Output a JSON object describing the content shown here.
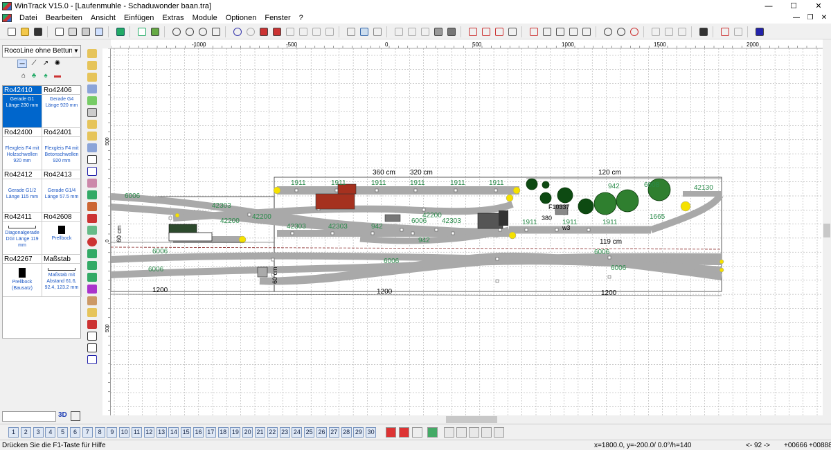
{
  "app": {
    "title": "WinTrack  V15.0 - [Laufenmuhle - Schaduwonder baan.tra]",
    "window_controls": [
      "—",
      "☐",
      "✕"
    ],
    "mdi_controls": [
      "—",
      "❐",
      "✕"
    ]
  },
  "menu": [
    "Datei",
    "Bearbeiten",
    "Ansicht",
    "Einfügen",
    "Extras",
    "Module",
    "Optionen",
    "Fenster",
    "?"
  ],
  "library": {
    "selected": "RocoLine ohne Bettung H",
    "parts": [
      {
        "id": "Ro42410",
        "desc": "Gerade G1 Länge 230 mm",
        "selected": true,
        "kind": "text"
      },
      {
        "id": "Ro42406",
        "desc": "Gerade G4 Länge 920 mm",
        "selected": false,
        "kind": "text"
      },
      {
        "id": "Ro42400",
        "desc": "Flexgleis F4 mit Holzschwellen 920 mm",
        "selected": false,
        "kind": "text"
      },
      {
        "id": "Ro42401",
        "desc": "Flexgleis F4 mit Betonschwellen 920 mm",
        "selected": false,
        "kind": "text"
      },
      {
        "id": "Ro42412",
        "desc": "Gerade G1/2 Länge 115 mm",
        "selected": false,
        "kind": "text"
      },
      {
        "id": "Ro42413",
        "desc": "Gerade G1/4 Länge 57.5 mm",
        "selected": false,
        "kind": "text"
      },
      {
        "id": "Ro42411",
        "desc": "Diagonalgerade DGI Länge 119 mm",
        "selected": false,
        "kind": "line"
      },
      {
        "id": "Ro42608",
        "desc": "Prellbock",
        "selected": false,
        "kind": "pic"
      },
      {
        "id": "Ro42267",
        "desc": "Prellbock (Bausatz)",
        "selected": false,
        "kind": "pic2"
      },
      {
        "id": "Maßstab",
        "desc": "Maßstab mit Abstand 61.6, 92.4, 123.2 mm",
        "selected": false,
        "kind": "line"
      }
    ],
    "three_d_label": "3D"
  },
  "ruler": {
    "h_labels": [
      "-1000",
      "-500",
      "0",
      "500",
      "1000",
      "1500",
      "2000"
    ],
    "v_labels": [
      "500",
      "0",
      "500"
    ]
  },
  "layout": {
    "track_labels": [
      "1911",
      "1911",
      "1911",
      "1911",
      "1911",
      "1911",
      "1911",
      "1911",
      "1911",
      "6006",
      "6006",
      "6006",
      "6006",
      "6006",
      "6006",
      "6006",
      "42303",
      "42303",
      "42303",
      "42303",
      "42200",
      "42200",
      "42200",
      "942",
      "942",
      "942",
      "1665",
      "42130",
      "6008"
    ],
    "dimension_labels": [
      "360 cm",
      "320 cm",
      "120 cm",
      "119 cm",
      "60 cm",
      "60 cm"
    ],
    "scale_labels": [
      "1200",
      "1200",
      "1200"
    ],
    "misc_labels": [
      "F10337",
      "380",
      "w3"
    ]
  },
  "layers": [
    "1",
    "2",
    "3",
    "4",
    "5",
    "6",
    "7",
    "8",
    "9",
    "10",
    "11",
    "12",
    "13",
    "14",
    "15",
    "16",
    "17",
    "18",
    "19",
    "20",
    "21",
    "22",
    "23",
    "24",
    "25",
    "26",
    "27",
    "28",
    "29",
    "30"
  ],
  "status": {
    "help": "Drücken Sie die  F1-Taste für Hilfe",
    "coords": "x=1800.0, y=-200.0/ 0.0°/h=140",
    "zoom": "<- 92 ->",
    "pos1": "+00666",
    "pos2": "+00888"
  }
}
